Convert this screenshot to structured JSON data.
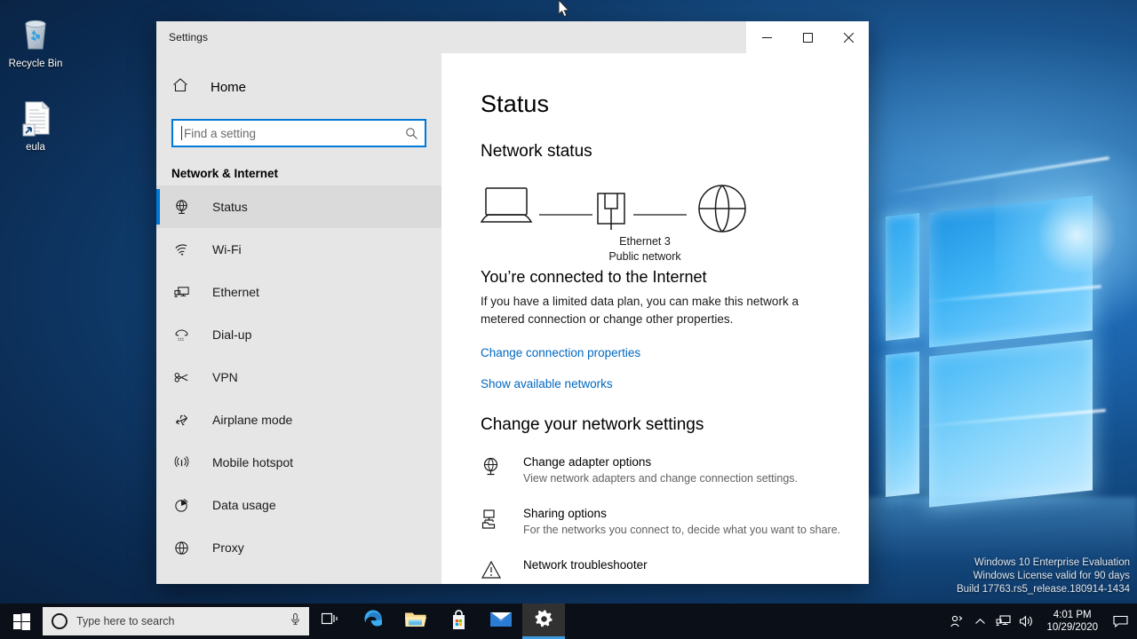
{
  "desktop": {
    "icons": [
      {
        "name": "Recycle Bin",
        "icon": "recycle-bin-icon"
      },
      {
        "name": "eula",
        "icon": "text-file-shortcut-icon"
      }
    ],
    "watermark": [
      "Windows 10 Enterprise Evaluation",
      "Windows License valid for 90 days",
      "Build 17763.rs5_release.180914-1434"
    ]
  },
  "window": {
    "title": "Settings",
    "controls": {
      "minimize": "minimize-button",
      "maximize": "maximize-button",
      "close": "close-button"
    }
  },
  "sidebar": {
    "home_label": "Home",
    "search": {
      "placeholder": "Find a setting",
      "value": ""
    },
    "section_title": "Network & Internet",
    "items": [
      {
        "label": "Status",
        "icon": "globe-monitor-icon",
        "selected": true
      },
      {
        "label": "Wi-Fi",
        "icon": "wifi-icon",
        "selected": false
      },
      {
        "label": "Ethernet",
        "icon": "ethernet-icon",
        "selected": false
      },
      {
        "label": "Dial-up",
        "icon": "dialup-icon",
        "selected": false
      },
      {
        "label": "VPN",
        "icon": "vpn-key-icon",
        "selected": false
      },
      {
        "label": "Airplane mode",
        "icon": "airplane-icon",
        "selected": false
      },
      {
        "label": "Mobile hotspot",
        "icon": "hotspot-icon",
        "selected": false
      },
      {
        "label": "Data usage",
        "icon": "pie-chart-icon",
        "selected": false
      },
      {
        "label": "Proxy",
        "icon": "globe-icon",
        "selected": false
      }
    ]
  },
  "content": {
    "page_title": "Status",
    "network_status_heading": "Network status",
    "diagram": {
      "device_icon": "laptop-icon",
      "adapter_icon": "ethernet-port-icon",
      "internet_icon": "globe-icon",
      "adapter_name": "Ethernet 3",
      "network_type": "Public network"
    },
    "connection_title": "You’re connected to the Internet",
    "connection_desc": "If you have a limited data plan, you can make this network a metered connection or change other properties.",
    "links": [
      "Change connection properties",
      "Show available networks"
    ],
    "change_settings_heading": "Change your network settings",
    "settings_rows": [
      {
        "title": "Change adapter options",
        "desc": "View network adapters and change connection settings.",
        "icon": "globe-monitor-icon"
      },
      {
        "title": "Sharing options",
        "desc": "For the networks you connect to, decide what you want to share.",
        "icon": "sharing-folder-icon"
      },
      {
        "title": "Network troubleshooter",
        "desc": "",
        "icon": "warning-triangle-icon"
      }
    ]
  },
  "taskbar": {
    "start": "windows-start-icon",
    "search_placeholder": "Type here to search",
    "mic_icon": "microphone-icon",
    "apps": [
      {
        "name": "task-view",
        "icon": "task-view-icon",
        "active": false
      },
      {
        "name": "microsoft-edge",
        "icon": "edge-icon",
        "active": false
      },
      {
        "name": "file-explorer",
        "icon": "folder-icon",
        "active": false
      },
      {
        "name": "microsoft-store",
        "icon": "store-bag-icon",
        "active": false
      },
      {
        "name": "mail",
        "icon": "mail-envelope-icon",
        "active": false
      },
      {
        "name": "settings",
        "icon": "gear-icon",
        "active": true
      }
    ],
    "tray": [
      {
        "name": "people-icon"
      },
      {
        "name": "show-hidden-icons-chevron"
      },
      {
        "name": "network-icon"
      },
      {
        "name": "volume-icon"
      }
    ],
    "clock_time": "4:01 PM",
    "clock_date": "10/29/2020",
    "action_center": "action-center-icon"
  },
  "colors": {
    "accent": "#0078d7",
    "link": "#0067c0",
    "sidebar_bg": "#e6e6e6",
    "taskbar_bg": "#0a0f18"
  }
}
